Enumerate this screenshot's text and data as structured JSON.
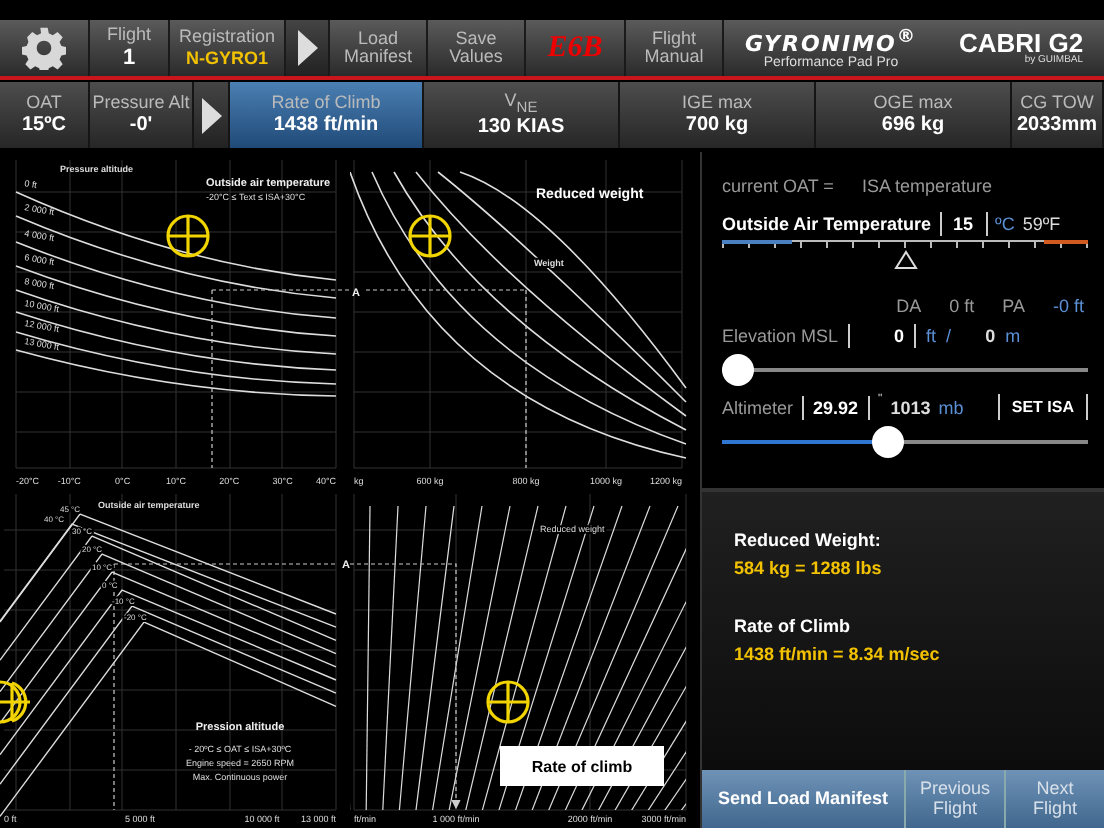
{
  "toolbar": {
    "flight": {
      "label": "Flight",
      "value": "1"
    },
    "registration": {
      "label": "Registration",
      "value": "N-GYRO1"
    },
    "buttons": [
      "Load Manifest",
      "Save Values"
    ],
    "e6b": "E6B",
    "manual": "Flight Manual",
    "logo": {
      "brand": "GYRONIMO$^{®}$",
      "subtitle": "Performance Pad Pro",
      "model": "CABRI G2",
      "maker": "by GUIMBAL"
    }
  },
  "readouts": [
    {
      "kind": "readout",
      "label": "OAT",
      "value": "15ºC",
      "selected": false
    },
    {
      "kind": "readout",
      "label": "Pressure Alt",
      "value": "-0'",
      "selected": false
    },
    {
      "kind": "arrow"
    },
    {
      "kind": "readout",
      "label": "Rate of Climb",
      "value": "1438 ft/min",
      "selected": true
    },
    {
      "kind": "readout",
      "label": "V$_{NE}$",
      "value": "130 KIAS",
      "selected": false
    },
    {
      "kind": "readout",
      "label": "IGE max",
      "value": "700 kg",
      "selected": false
    },
    {
      "kind": "readout",
      "label": "OGE max",
      "value": "696 kg",
      "selected": false
    },
    {
      "kind": "readout",
      "label": "CG TOW",
      "value": "2033mm",
      "selected": false
    }
  ],
  "chart_temperature": {
    "titles": [
      "Pressure altitude",
      "Outside air temperature",
      "-20°C ≤ Text ≤ ISA+30°C"
    ],
    "curve_labels": [
      "0 ft",
      "2 000 ft",
      "4 000 ft",
      "6 000 ft",
      "8 000 ft",
      "10 000 ft",
      "12 000 ft",
      "13 000 ft"
    ],
    "axis_labels": [
      "-20°C",
      "-10°C",
      "0°C",
      "10°C",
      "20°C",
      "30°C",
      "40°C"
    ]
  },
  "chart_weight": {
    "title": "Reduced weight",
    "subtitle": "Weight",
    "point": "A",
    "axis_labels": [
      "kg",
      "600 kg",
      "800 kg",
      "1000 kg",
      "1200 kg"
    ]
  },
  "chart_altitude": {
    "title": "Outside air temperature",
    "point": "A",
    "curve_labels": [
      "45 °C",
      "40 °C",
      "30 °C",
      "20 °C",
      "10 °C",
      "0 °C",
      "-10 °C",
      "-20 °C"
    ],
    "heading": "Pression altitude",
    "notes": [
      "- 20ºC ≤ OAT ≤ ISA+30ºC",
      "Engine speed = 2650 RPM",
      "Max. Continuous power"
    ],
    "axis_labels": [
      "0 ft",
      "5 000 ft",
      "10 000 ft",
      "13 000 ft"
    ]
  },
  "chart_climb": {
    "title": "Reduced weight",
    "result": "Rate of climb",
    "axis_labels": [
      "ft/min",
      "1 000 ft/min",
      "2000 ft/min",
      "3000 ft/min"
    ]
  },
  "oat": {
    "prefix": "current OAT =",
    "mode": "ISA temperature",
    "label": "Outside Air Temperature",
    "value": "15",
    "unit": "ºC",
    "fahrenheit": "59ºF",
    "level": 0.5
  },
  "elevation": {
    "da_label": "DA",
    "da_value": "0 ft",
    "pa_label": "PA",
    "pa_value": "-0 ft",
    "label": "Elevation MSL",
    "value": "0",
    "unit": "ft",
    "separator": "/",
    "meters": "0",
    "meters_unit": "m",
    "level": 0
  },
  "altimeter": {
    "label": "Altimeter",
    "value": "29.92",
    "unit": "\"",
    "mb": "1013",
    "mb_unit": "mb",
    "button": "SET ISA",
    "level": 0.45
  },
  "results": [
    {
      "label": "Reduced Weight:",
      "value": "584 kg = 1288 lbs"
    },
    {
      "label": "Rate of Climb",
      "value": "1438 ft/min = 8.34 m/sec"
    }
  ],
  "footer": [
    "Send Load Manifest",
    "Previous Flight",
    "Next Flight"
  ]
}
